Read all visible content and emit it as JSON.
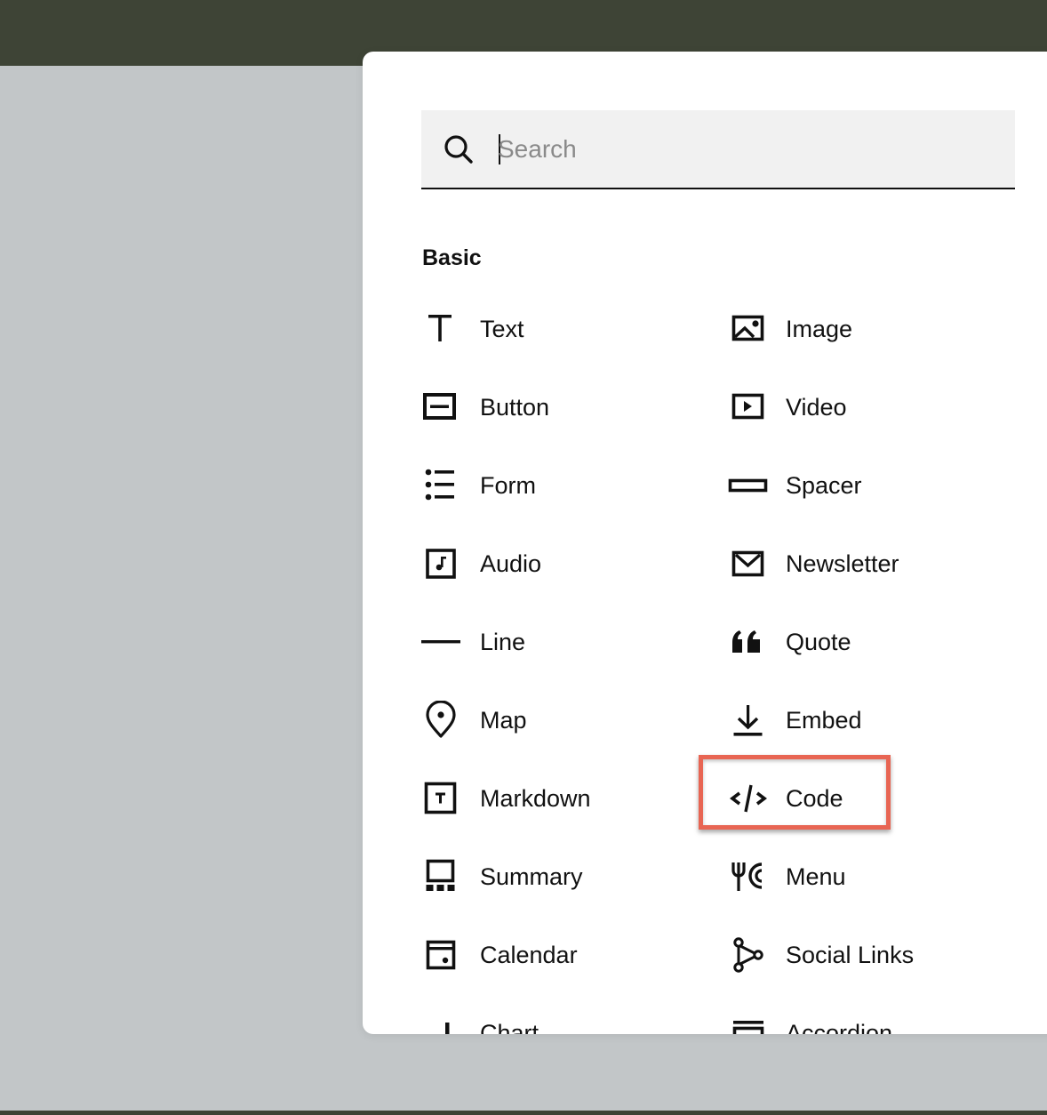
{
  "search": {
    "placeholder": "Search",
    "value": ""
  },
  "section": {
    "title": "Basic"
  },
  "blocks": {
    "left": [
      {
        "label": "Text",
        "icon": "text-icon"
      },
      {
        "label": "Button",
        "icon": "button-icon"
      },
      {
        "label": "Form",
        "icon": "form-icon"
      },
      {
        "label": "Audio",
        "icon": "audio-icon"
      },
      {
        "label": "Line",
        "icon": "line-icon"
      },
      {
        "label": "Map",
        "icon": "map-pin-icon"
      },
      {
        "label": "Markdown",
        "icon": "markdown-icon"
      },
      {
        "label": "Summary",
        "icon": "summary-icon"
      },
      {
        "label": "Calendar",
        "icon": "calendar-icon"
      },
      {
        "label": "Chart",
        "icon": "chart-icon"
      }
    ],
    "right": [
      {
        "label": "Image",
        "icon": "image-icon"
      },
      {
        "label": "Video",
        "icon": "video-icon"
      },
      {
        "label": "Spacer",
        "icon": "spacer-icon"
      },
      {
        "label": "Newsletter",
        "icon": "envelope-icon"
      },
      {
        "label": "Quote",
        "icon": "quote-icon"
      },
      {
        "label": "Embed",
        "icon": "embed-icon"
      },
      {
        "label": "Code",
        "icon": "code-icon"
      },
      {
        "label": "Menu",
        "icon": "menu-icon"
      },
      {
        "label": "Social Links",
        "icon": "social-links-icon"
      },
      {
        "label": "Accordion",
        "icon": "accordion-icon"
      }
    ]
  },
  "highlighted_block": "Code",
  "colors": {
    "top_bar": "#3e4436",
    "background": "#c2c6c8",
    "highlight": "#e86553"
  }
}
